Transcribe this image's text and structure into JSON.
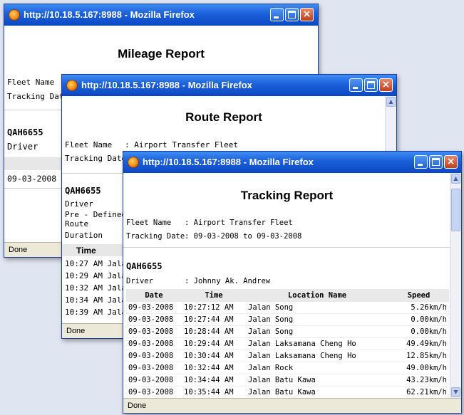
{
  "windows": {
    "mileage": {
      "title": "http://10.18.5.167:8988 - Mozilla Firefox",
      "report_title": "Mileage Report",
      "fleet_label": "Fleet Name",
      "tracking_label": "Tracking Dat",
      "vehicle": "QAH6655",
      "driver_label": "Driver",
      "date_value": "09-03-2008",
      "status": "Done"
    },
    "route": {
      "title": "http://10.18.5.167:8988 - Mozilla Firefox",
      "report_title": "Route Report",
      "fleet_label": "Fleet Name",
      "fleet_value": ": Airport Transfer Fleet",
      "tracking_label": "Tracking Date",
      "vehicle": "QAH6655",
      "driver_label": "Driver",
      "predefined_label": "Pre - Defined",
      "route_label": "Route",
      "duration_label": "Duration",
      "time_header": "Time",
      "times": [
        {
          "time": "10:27 AM",
          "loc": "Jala"
        },
        {
          "time": "10:29 AM",
          "loc": "Jala"
        },
        {
          "time": "10:32 AM",
          "loc": "Jala"
        },
        {
          "time": "10:34 AM",
          "loc": "Jala"
        },
        {
          "time": "10:39 AM",
          "loc": "Jala"
        }
      ],
      "status": "Done"
    },
    "tracking": {
      "title": "http://10.18.5.167:8988 - Mozilla Firefox",
      "report_title": "Tracking Report",
      "fleet_label": "Fleet Name",
      "fleet_value": ": Airport Transfer Fleet",
      "tracking_label": "Tracking Date",
      "tracking_value": ": 09-03-2008 to 09-03-2008",
      "vehicle": "QAH6655",
      "driver_label": "Driver",
      "driver_value": ": Johnny Ak. Andrew",
      "columns": [
        "Date",
        "Time",
        "Location Name",
        "Speed"
      ],
      "rows": [
        [
          "09-03-2008",
          "10:27:12 AM",
          "Jalan Song",
          "5.26km/h"
        ],
        [
          "09-03-2008",
          "10:27:44 AM",
          "Jalan Song",
          "0.00km/h"
        ],
        [
          "09-03-2008",
          "10:28:44 AM",
          "Jalan Song",
          "0.00km/h"
        ],
        [
          "09-03-2008",
          "10:29:44 AM",
          "Jalan Laksamana Cheng Ho",
          "49.49km/h"
        ],
        [
          "09-03-2008",
          "10:30:44 AM",
          "Jalan Laksamana Cheng Ho",
          "12.85km/h"
        ],
        [
          "09-03-2008",
          "10:32:44 AM",
          "Jalan Rock",
          "49.00km/h"
        ],
        [
          "09-03-2008",
          "10:34:44 AM",
          "Jalan Batu Kawa",
          "43.23km/h"
        ],
        [
          "09-03-2008",
          "10:35:44 AM",
          "Jalan Batu Kawa",
          "62.21km/h"
        ]
      ],
      "status": "Done"
    }
  },
  "icons": {
    "browser": "firefox-icon",
    "minimize": "minimize-icon",
    "maximize": "maximize-icon",
    "close": "close-icon",
    "close_glyph": "×"
  }
}
